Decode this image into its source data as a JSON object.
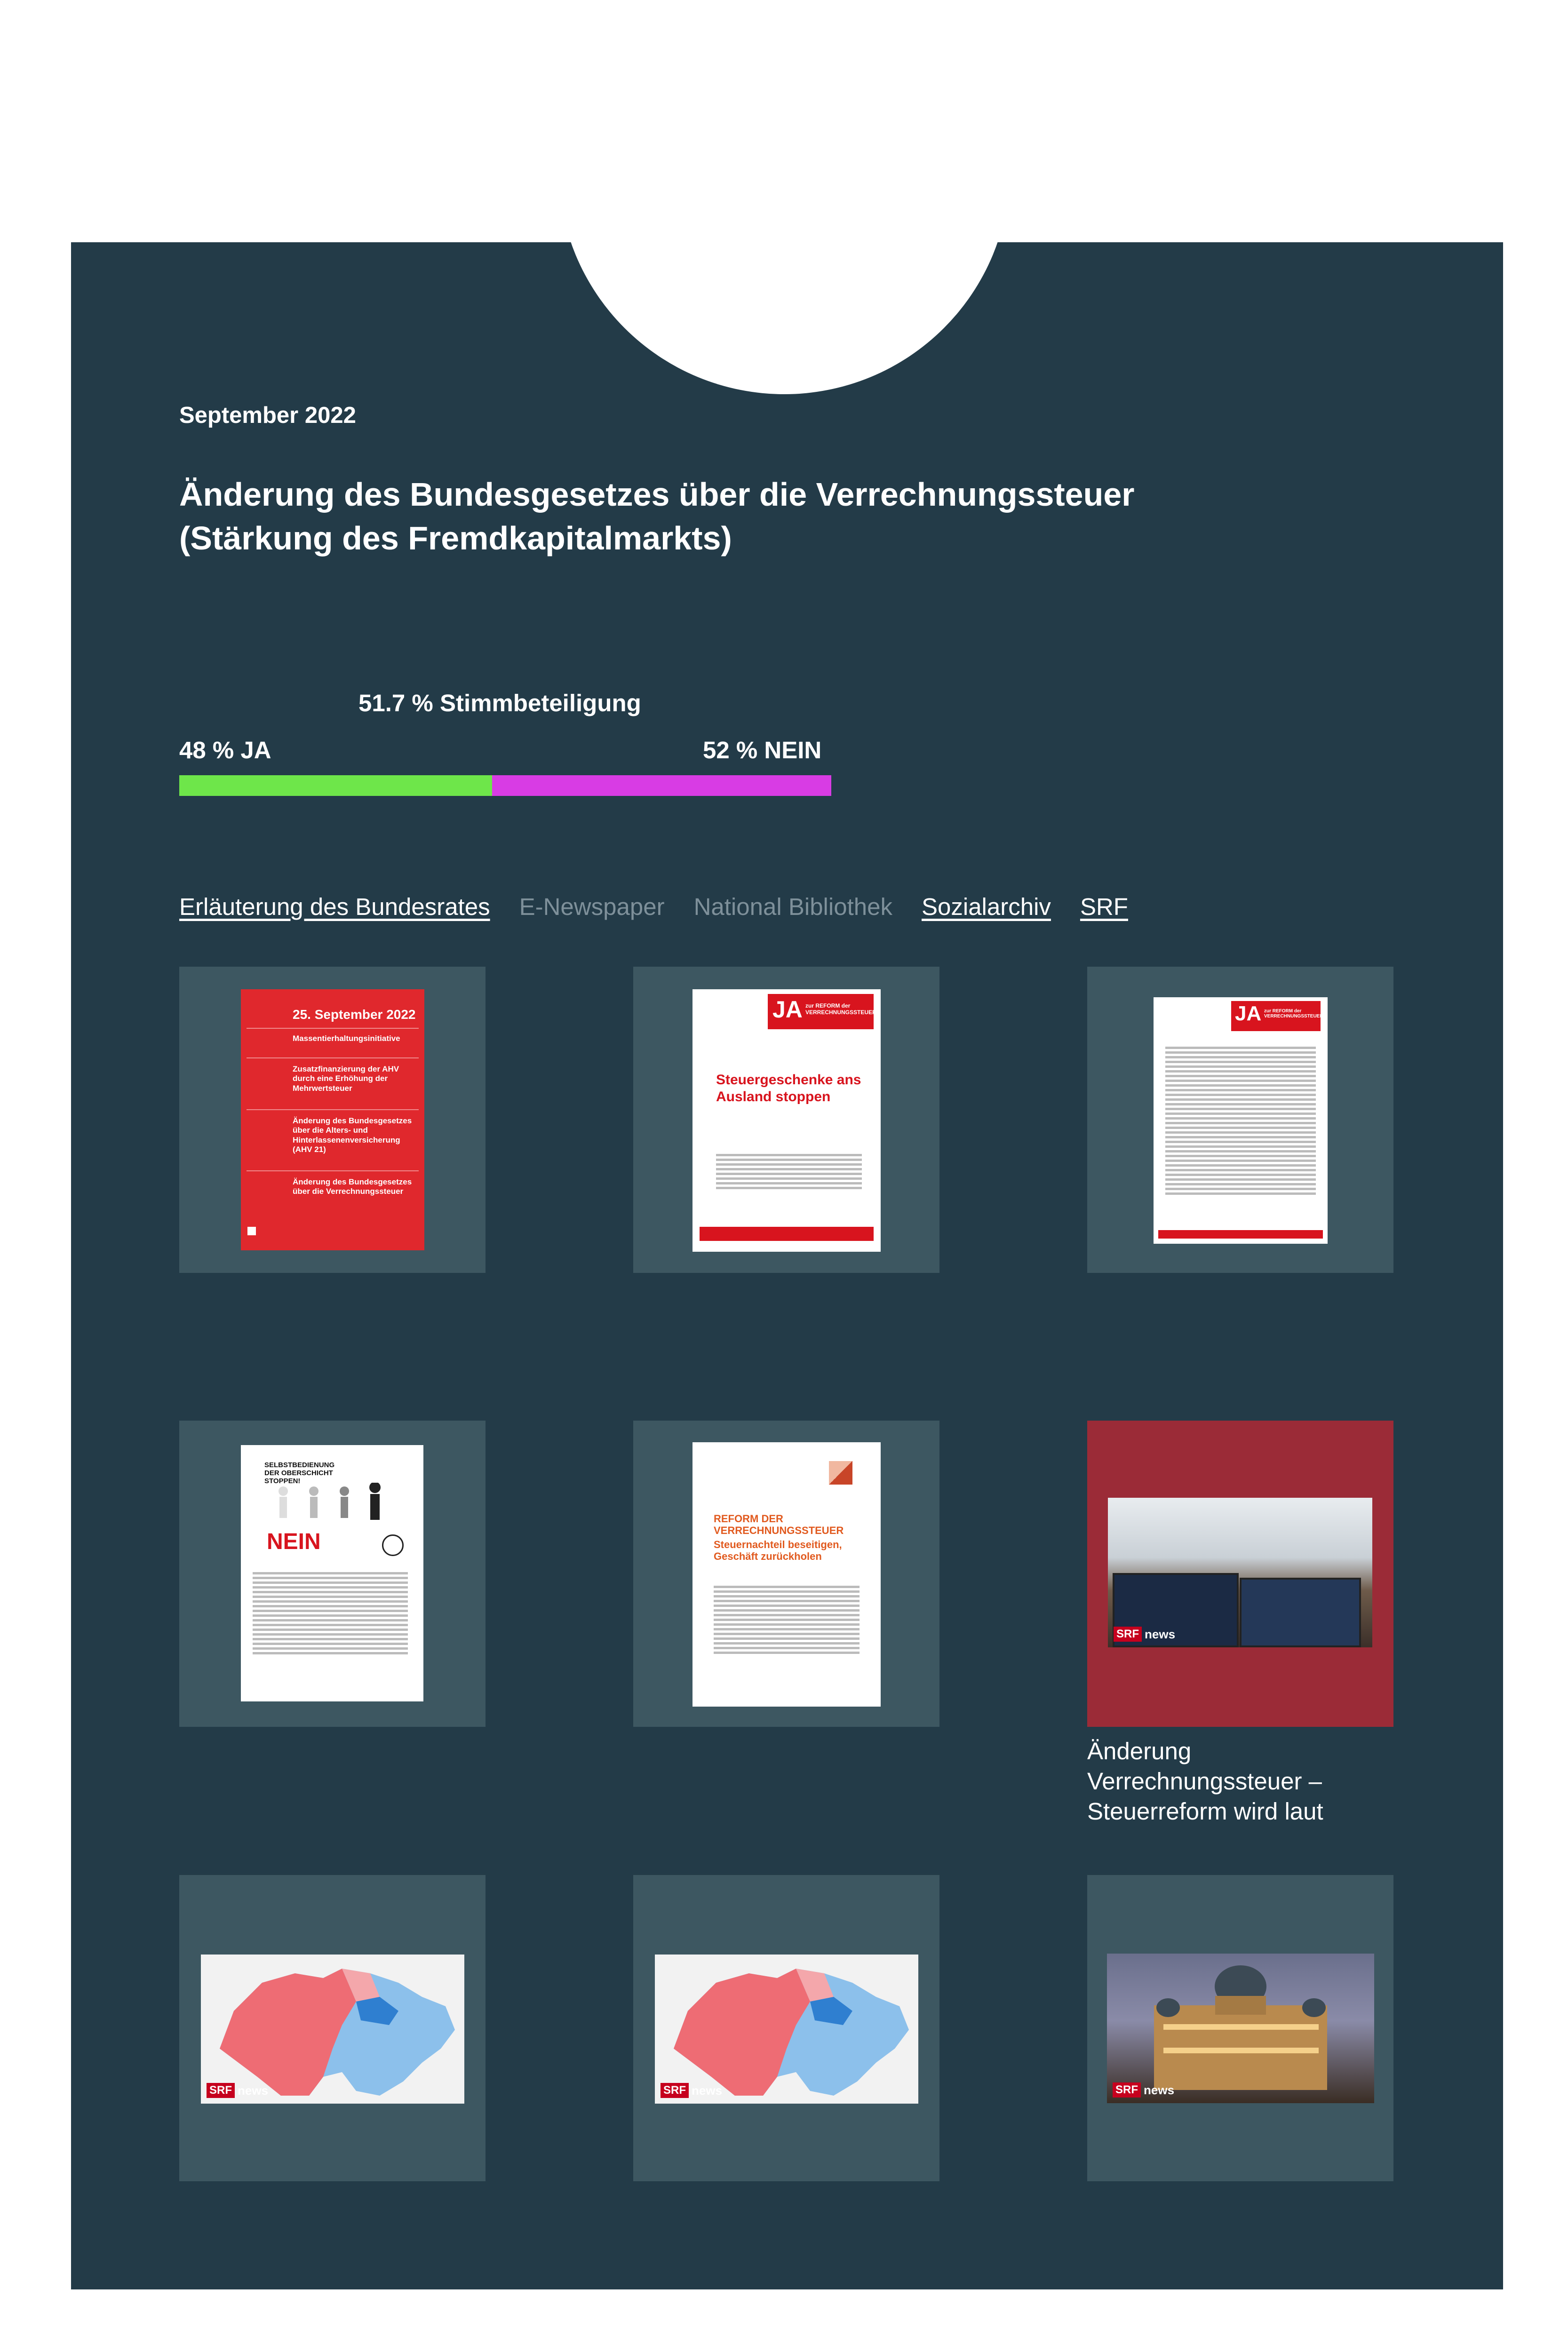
{
  "header": {
    "date": "September 2022",
    "title": "Änderung des Bundesgesetzes über die Verrechnungssteuer (Stärkung des Fremdkapitalmarkts)"
  },
  "results": {
    "turnout_label": "51.7 % Stimmbeteiligung",
    "ja_label": "48 % JA",
    "nein_label": "52 % NEIN",
    "ja_percent": 48,
    "nein_percent": 52,
    "ja_color": "#6ee64a",
    "nein_color": "#d83ce4"
  },
  "links": [
    {
      "label": "Erläuterung des Bundesrates",
      "active": true
    },
    {
      "label": "E-Newspaper",
      "active": false
    },
    {
      "label": "National Bibliothek",
      "active": false
    },
    {
      "label": "Sozialarchiv",
      "active": true
    },
    {
      "label": "SRF",
      "active": true
    }
  ],
  "docs": {
    "d1": {
      "date": "25. September 2022",
      "items": [
        "Massentierhaltungsinitiative",
        "Zusatzfinanzierung der AHV durch eine Erhöhung der Mehrwertsteuer",
        "Änderung des Bundesgesetzes über die Alters- und Hinterlassenenversicherung (AHV 21)",
        "Änderung des Bundesgesetzes über die Verrechnungssteuer"
      ]
    },
    "d2": {
      "banner_big": "JA",
      "banner_small": "zur REFORM der VERRECHNUNGSSTEUER",
      "headline": "Steuergeschenke ans Ausland stoppen"
    },
    "d3": {
      "banner_big": "JA",
      "banner_small": "zur REFORM der VERRECHNUNGSSTEUER"
    },
    "d4": {
      "headline": "SELBSTBEDIENUNG DER OBERSCHICHT STOPPEN!",
      "nein": "NEIN"
    },
    "d5": {
      "headline": "REFORM DER VERRECHNUNGSSTEUER",
      "subhead": "Steuernachteil beseitigen, Geschäft zurückholen"
    }
  },
  "srf": {
    "badge": "SRF",
    "brand": "news",
    "caption": "Änderung Verrechnungssteuer – Steuerreform wird laut"
  },
  "colors": {
    "panel": "#233b48",
    "tile": "#3d5761",
    "tile_accent": "#9b2b37"
  }
}
